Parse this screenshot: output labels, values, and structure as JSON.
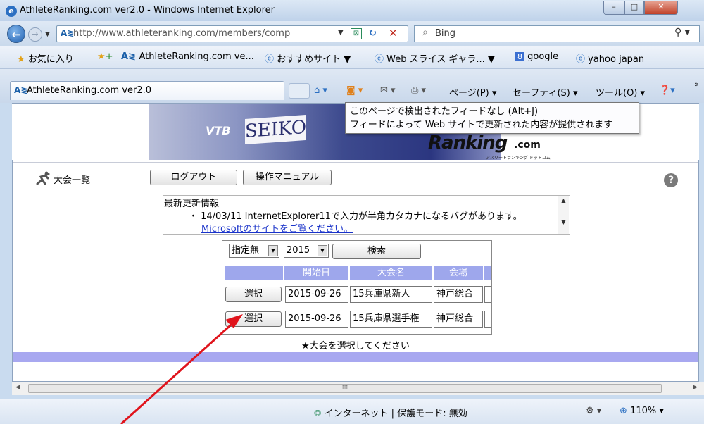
{
  "window": {
    "title": "AthleteRanking.com ver2.0 - Windows Internet Explorer",
    "min_glyph": "–",
    "max_glyph": "□",
    "close_glyph": "✕"
  },
  "navbar": {
    "back_glyph": "←",
    "forward_glyph": "→",
    "address_url": "http://www.athleteranking.com/members/comp",
    "search_placeholder": "Bing"
  },
  "favorites": {
    "favorites_label": "お気に入り",
    "items": [
      "AthleteRanking.com ve...",
      "おすすめサイト ▼",
      "Web スライス ギャラ... ▼",
      "google",
      "yahoo japan"
    ]
  },
  "tabs": {
    "active_tab": "AthleteRanking.com ver2.0"
  },
  "command_bar": {
    "page": "ページ(P) ▾",
    "safety": "セーフティ(S) ▾",
    "tools": "ツール(O) ▾",
    "more": "»"
  },
  "tooltip": {
    "line1": "このページで検出されたフィードなし (Alt+J)",
    "line2": "フィードによって Web サイトで更新された内容が提供されます"
  },
  "banner": {
    "seiko": "SEIKO",
    "vtb": "VTB",
    "logo_main": "Ranking",
    "logo_suffix": ".com",
    "logo_sub": "アスリートランキング ドットコム"
  },
  "page": {
    "nav_label": "大会一覧",
    "logout_button": "ログアウト",
    "manual_button": "操作マニュアル",
    "help_glyph": "?"
  },
  "news": {
    "title": "最新更新情報",
    "item": "・ 14/03/11 InternetExplorer11で入力が半角カタカナになるバグがあります。",
    "link": "Microsoftのサイトをご覧ください。"
  },
  "filters": {
    "category_value": "指定無",
    "year_value": "2015",
    "search_button": "検索"
  },
  "table": {
    "headers": [
      "開始日",
      "大会名",
      "会場"
    ],
    "rows": [
      {
        "select": "選択",
        "date": "2015-09-26",
        "name": "15兵庫県新人",
        "venue": "神戸総合"
      },
      {
        "select": "選択",
        "date": "2015-09-26",
        "name": "15兵庫県選手権",
        "venue": "神戸総合"
      }
    ]
  },
  "hint": "★大会を選択してください",
  "status": {
    "zone": "インターネット | 保護モード: 無効",
    "zoom": "110%"
  },
  "colors": {
    "header_blue": "#9ea7ec",
    "footer_bar": "#a8a8f0",
    "annotation_arrow": "#e0141c"
  }
}
